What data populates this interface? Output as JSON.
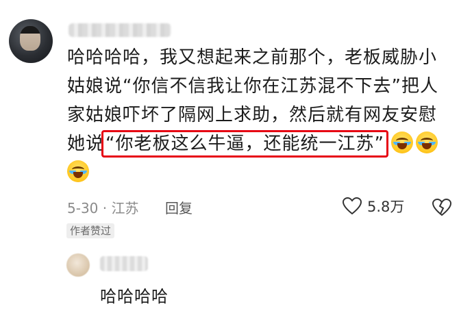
{
  "comment": {
    "lines": [
      "哈哈哈哈，我又想起来之前那个，老板威胁小",
      "姑娘说“你信不信我让你在江苏混不下去”把人",
      "家姑娘吓坏了隔网上求助，然后就有网友安慰",
      "她说"
    ],
    "highlighted_quote": "“你老板这么牛逼，还能统一江苏”",
    "emoji_name": "laugh-cry-emoji",
    "highlight_color": "#e60012"
  },
  "meta": {
    "date_location": "5-30 · 江苏",
    "reply_label": "回复",
    "like_count": "5.8万"
  },
  "author_badge": "作者赞过",
  "reply": {
    "text": "哈哈哈哈"
  }
}
